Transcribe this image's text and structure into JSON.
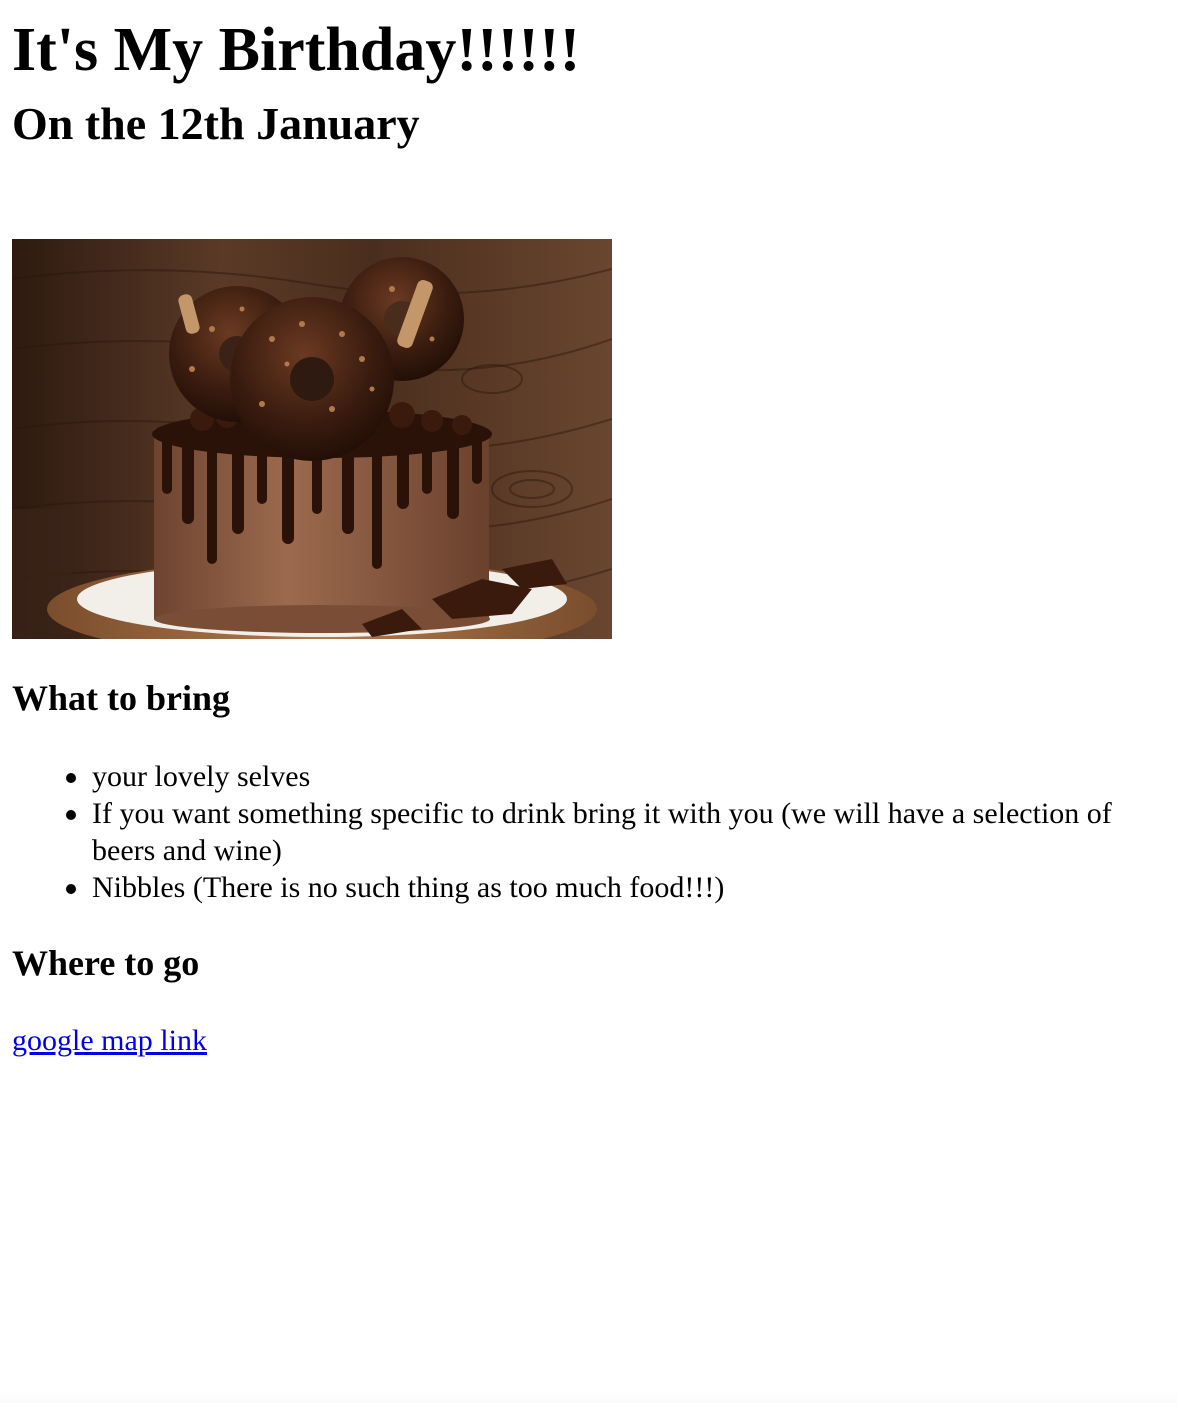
{
  "header": {
    "title": "It's My Birthday!!!!!!",
    "date_line": "On the 12th January"
  },
  "image": {
    "subject": "chocolate drip cake topped with chocolate donuts on wooden background",
    "icon": "cake-photo",
    "colors": {
      "wood_dark": "#3b2316",
      "wood_light": "#6b4630",
      "cake": "#8a5a40",
      "drip": "#2a1209",
      "board": "#a47048",
      "plate": "#f2efe9"
    }
  },
  "what_to_bring": {
    "heading": "What to bring",
    "items": [
      "your lovely selves",
      "If you want something specific to drink bring it with you (we will have a selection of beers and wine)",
      "Nibbles (There is no such thing as too much food!!!)"
    ]
  },
  "where_to_go": {
    "heading": "Where to go",
    "link_text": "google map link",
    "link_color": "#0000ee"
  }
}
